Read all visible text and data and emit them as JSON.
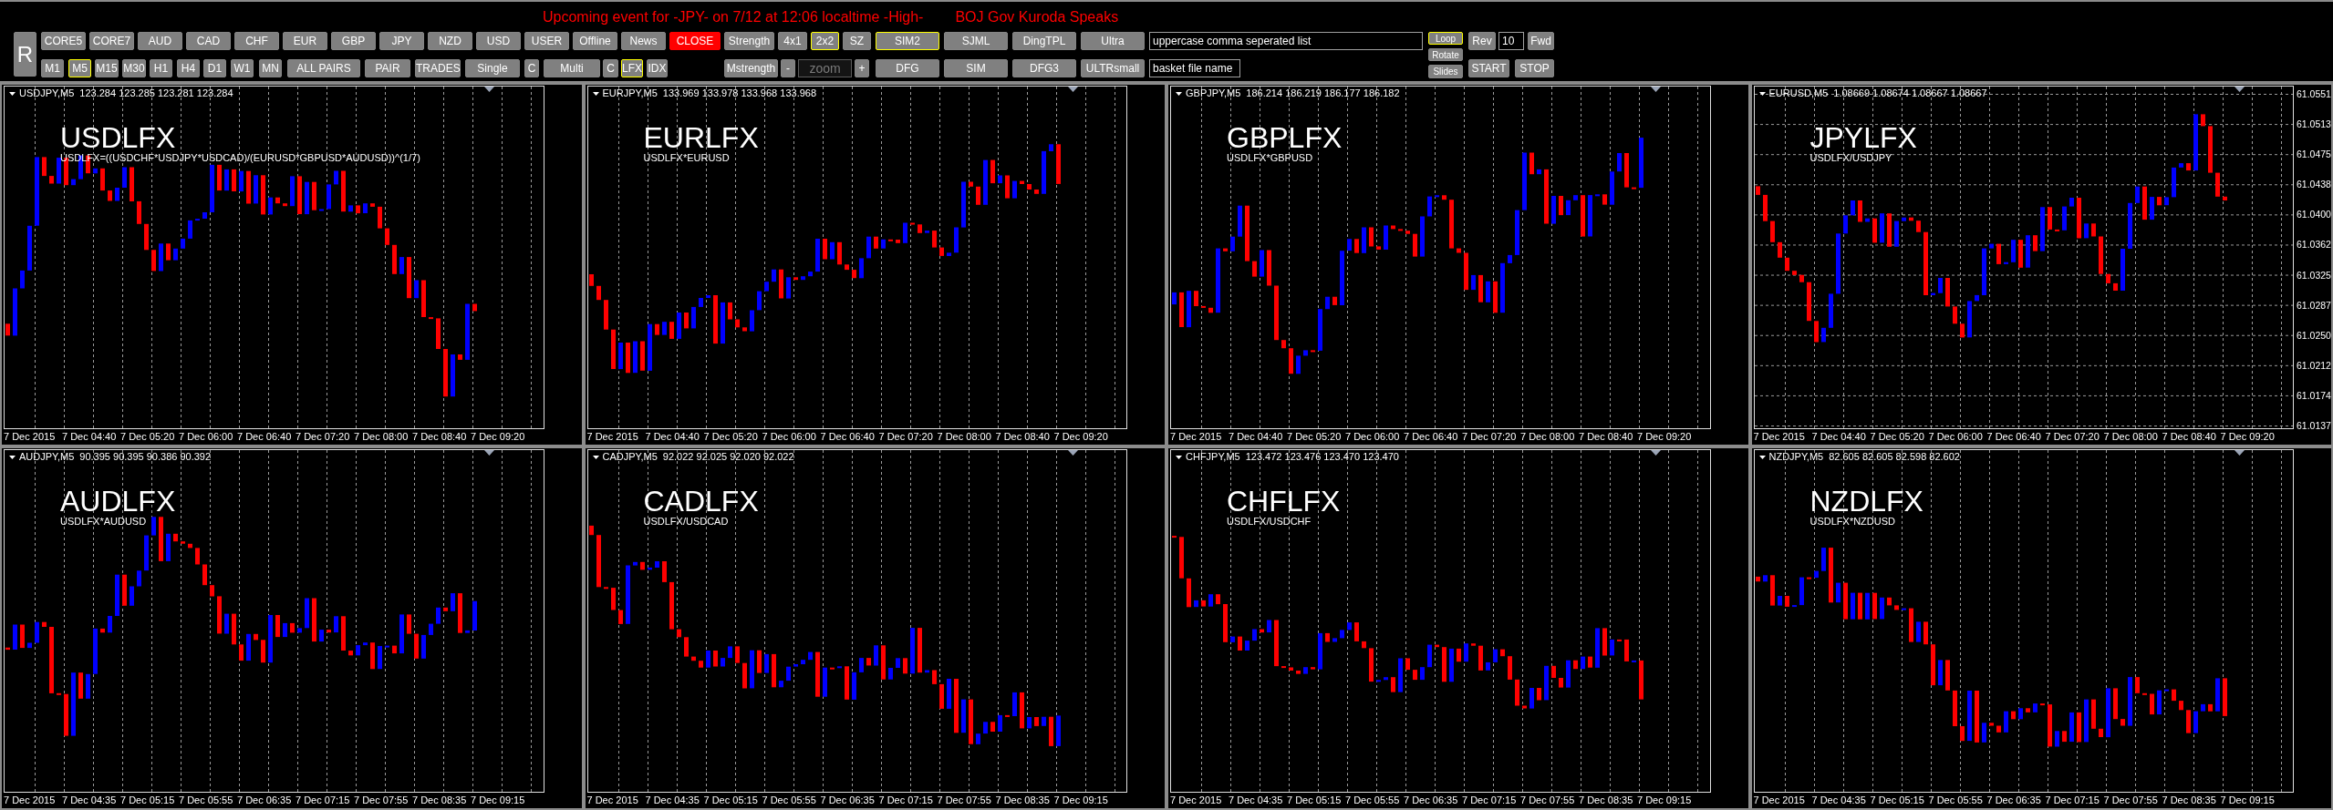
{
  "event_banner": {
    "notice": "Upcoming event for -JPY- on 7/12 at 12:06 localtime -High-",
    "event": "BOJ Gov Kuroda Speaks"
  },
  "toolbar": {
    "reset_button": {
      "label": "R"
    },
    "row_1": [
      {
        "kind": "button",
        "label": "CORE5",
        "selected": false
      },
      {
        "kind": "button",
        "label": "CORE7",
        "selected": false
      },
      {
        "kind": "button",
        "label": "AUD",
        "selected": false
      },
      {
        "kind": "button",
        "label": "CAD",
        "selected": false
      },
      {
        "kind": "button",
        "label": "CHF",
        "selected": false
      },
      {
        "kind": "button",
        "label": "EUR",
        "selected": false
      },
      {
        "kind": "button",
        "label": "GBP",
        "selected": false
      },
      {
        "kind": "button",
        "label": "JPY",
        "selected": false
      },
      {
        "kind": "button",
        "label": "NZD",
        "selected": false
      },
      {
        "kind": "button",
        "label": "USD",
        "selected": false
      },
      {
        "kind": "button",
        "label": "USER",
        "selected": false
      },
      {
        "kind": "button",
        "label": "Offline",
        "selected": false
      },
      {
        "kind": "button",
        "label": "News",
        "selected": false
      },
      {
        "kind": "alert",
        "label": "CLOSE",
        "selected": false
      },
      {
        "kind": "button",
        "label": "Strength",
        "selected": false
      },
      {
        "kind": "button",
        "label": "4x1",
        "selected": false
      },
      {
        "kind": "button",
        "label": "2x2",
        "selected": true
      },
      {
        "kind": "button",
        "label": "SZ",
        "selected": false
      },
      {
        "kind": "button",
        "label": "SIM2",
        "selected": true
      },
      {
        "kind": "button",
        "label": "SJML",
        "selected": false
      },
      {
        "kind": "button",
        "label": "DingTPL",
        "selected": false
      },
      {
        "kind": "button",
        "label": "Ultra",
        "selected": false
      },
      {
        "kind": "field",
        "value": "uppercase comma seperated list"
      }
    ],
    "row_2": [
      {
        "kind": "button",
        "label": "M1",
        "selected": false
      },
      {
        "kind": "button",
        "label": "M5",
        "selected": true
      },
      {
        "kind": "button",
        "label": "M15",
        "selected": false
      },
      {
        "kind": "button",
        "label": "M30",
        "selected": false
      },
      {
        "kind": "button",
        "label": "H1",
        "selected": false
      },
      {
        "kind": "button",
        "label": "H4",
        "selected": false
      },
      {
        "kind": "button",
        "label": "D1",
        "selected": false
      },
      {
        "kind": "button",
        "label": "W1",
        "selected": false
      },
      {
        "kind": "button",
        "label": "MN",
        "selected": false
      },
      {
        "kind": "button",
        "label": "ALL PAIRS",
        "selected": false
      },
      {
        "kind": "button",
        "label": "PAIR",
        "selected": false
      },
      {
        "kind": "button",
        "label": "TRADES",
        "selected": false
      },
      {
        "kind": "button",
        "label": "Single",
        "selected": false
      },
      {
        "kind": "button",
        "label": "C",
        "selected": false
      },
      {
        "kind": "button",
        "label": "Multi",
        "selected": false
      },
      {
        "kind": "button",
        "label": "C",
        "selected": false
      },
      {
        "kind": "button",
        "label": "LFX",
        "selected": true
      },
      {
        "kind": "button",
        "label": "IDX",
        "selected": false
      },
      {
        "kind": "button",
        "label": "Mstrength",
        "selected": false
      },
      {
        "kind": "button",
        "label": "-",
        "selected": false
      },
      {
        "kind": "field",
        "placeholder": "zoom"
      },
      {
        "kind": "button",
        "label": "+",
        "selected": false
      },
      {
        "kind": "button",
        "label": "DFG",
        "selected": false
      },
      {
        "kind": "button",
        "label": "SIM",
        "selected": false
      },
      {
        "kind": "button",
        "label": "DFG3",
        "selected": false
      },
      {
        "kind": "button",
        "label": "ULTRsmall",
        "selected": false
      },
      {
        "kind": "field",
        "value": "basket file name"
      }
    ],
    "rotation_toggles": [
      {
        "label": "Loop",
        "selected": true
      },
      {
        "label": "Rotate",
        "selected": false
      },
      {
        "label": "Slides",
        "selected": false
      }
    ],
    "step_row": [
      {
        "kind": "button",
        "label": "Rev",
        "selected": false
      },
      {
        "kind": "field",
        "value": "10"
      },
      {
        "kind": "button",
        "label": "Fwd",
        "selected": false
      }
    ],
    "run_row": [
      {
        "kind": "button",
        "label": "START",
        "selected": false
      },
      {
        "kind": "button",
        "label": "STOP",
        "selected": false
      }
    ]
  },
  "charts": [
    {
      "symbol": "USDJPY,M5",
      "quotes": "123.284 123.285 123.281 123.284",
      "index_name": "USDLFX",
      "formula": "USDLFX=((USDCHF*USDJPY*USDCAD)/(EURUSD*GBPUSD*AUDUSD))^(1/7)",
      "time_axis": [
        "7 Dec 2015",
        "7 Dec 04:40",
        "7 Dec 05:20",
        "7 Dec 06:00",
        "7 Dec 06:40",
        "7 Dec 07:20",
        "7 Dec 08:00",
        "7 Dec 08:40",
        "7 Dec 09:20"
      ]
    },
    {
      "symbol": "EURJPY,M5",
      "quotes": "133.969 133.978 133.968 133.968",
      "index_name": "EURLFX",
      "formula": "USDLFX*EURUSD",
      "time_axis": [
        "7 Dec 2015",
        "7 Dec 04:40",
        "7 Dec 05:20",
        "7 Dec 06:00",
        "7 Dec 06:40",
        "7 Dec 07:20",
        "7 Dec 08:00",
        "7 Dec 08:40",
        "7 Dec 09:20"
      ]
    },
    {
      "symbol": "GBPJPY,M5",
      "quotes": "186.214 186.219 186.177 186.182",
      "index_name": "GBPLFX",
      "formula": "USDLFX*GBPUSD",
      "time_axis": [
        "7 Dec 2015",
        "7 Dec 04:40",
        "7 Dec 05:20",
        "7 Dec 06:00",
        "7 Dec 06:40",
        "7 Dec 07:20",
        "7 Dec 08:00",
        "7 Dec 08:40",
        "7 Dec 09:20"
      ]
    },
    {
      "symbol": "EURUSD,M5",
      "quotes": "1.08669 1.08674 1.08667 1.08667",
      "index_name": "JPYLFX",
      "formula": "USDLFX/USDJPY",
      "time_axis": [
        "7 Dec 2015",
        "7 Dec 04:40",
        "7 Dec 05:20",
        "7 Dec 06:00",
        "7 Dec 06:40",
        "7 Dec 07:20",
        "7 Dec 08:00",
        "7 Dec 08:40",
        "7 Dec 09:20"
      ],
      "price_axis": [
        "61.0551",
        "61.0513",
        "61.0475",
        "61.0438",
        "61.0400",
        "61.0362",
        "61.0325",
        "61.0287",
        "61.0250",
        "61.0212",
        "61.0174",
        "61.0137"
      ]
    },
    {
      "symbol": "AUDJPY,M5",
      "quotes": "90.395 90.395 90.386 90.392",
      "index_name": "AUDLFX",
      "formula": "USDLFX*AUDUSD",
      "time_axis": [
        "7 Dec 2015",
        "7 Dec 04:35",
        "7 Dec 05:15",
        "7 Dec 05:55",
        "7 Dec 06:35",
        "7 Dec 07:15",
        "7 Dec 07:55",
        "7 Dec 08:35",
        "7 Dec 09:15"
      ]
    },
    {
      "symbol": "CADJPY,M5",
      "quotes": "92.022 92.025 92.020 92.022",
      "index_name": "CADLFX",
      "formula": "USDLFX/USDCAD",
      "time_axis": [
        "7 Dec 2015",
        "7 Dec 04:35",
        "7 Dec 05:15",
        "7 Dec 05:55",
        "7 Dec 06:35",
        "7 Dec 07:15",
        "7 Dec 07:55",
        "7 Dec 08:35",
        "7 Dec 09:15"
      ]
    },
    {
      "symbol": "CHFJPY,M5",
      "quotes": "123.472 123.476 123.470 123.470",
      "index_name": "CHFLFX",
      "formula": "USDLFX/USDCHF",
      "time_axis": [
        "7 Dec 2015",
        "7 Dec 04:35",
        "7 Dec 05:15",
        "7 Dec 05:55",
        "7 Dec 06:35",
        "7 Dec 07:15",
        "7 Dec 07:55",
        "7 Dec 08:35",
        "7 Dec 09:15"
      ]
    },
    {
      "symbol": "NZDJPY,M5",
      "quotes": "82.605 82.605 82.598 82.602",
      "index_name": "NZDLFX",
      "formula": "USDLFX*NZDUSD",
      "time_axis": [
        "7 Dec 2015",
        "7 Dec 04:35",
        "7 Dec 05:15",
        "7 Dec 05:55",
        "7 Dec 06:35",
        "7 Dec 07:15",
        "7 Dec 07:55",
        "7 Dec 08:35",
        "7 Dec 09:15"
      ]
    }
  ]
}
